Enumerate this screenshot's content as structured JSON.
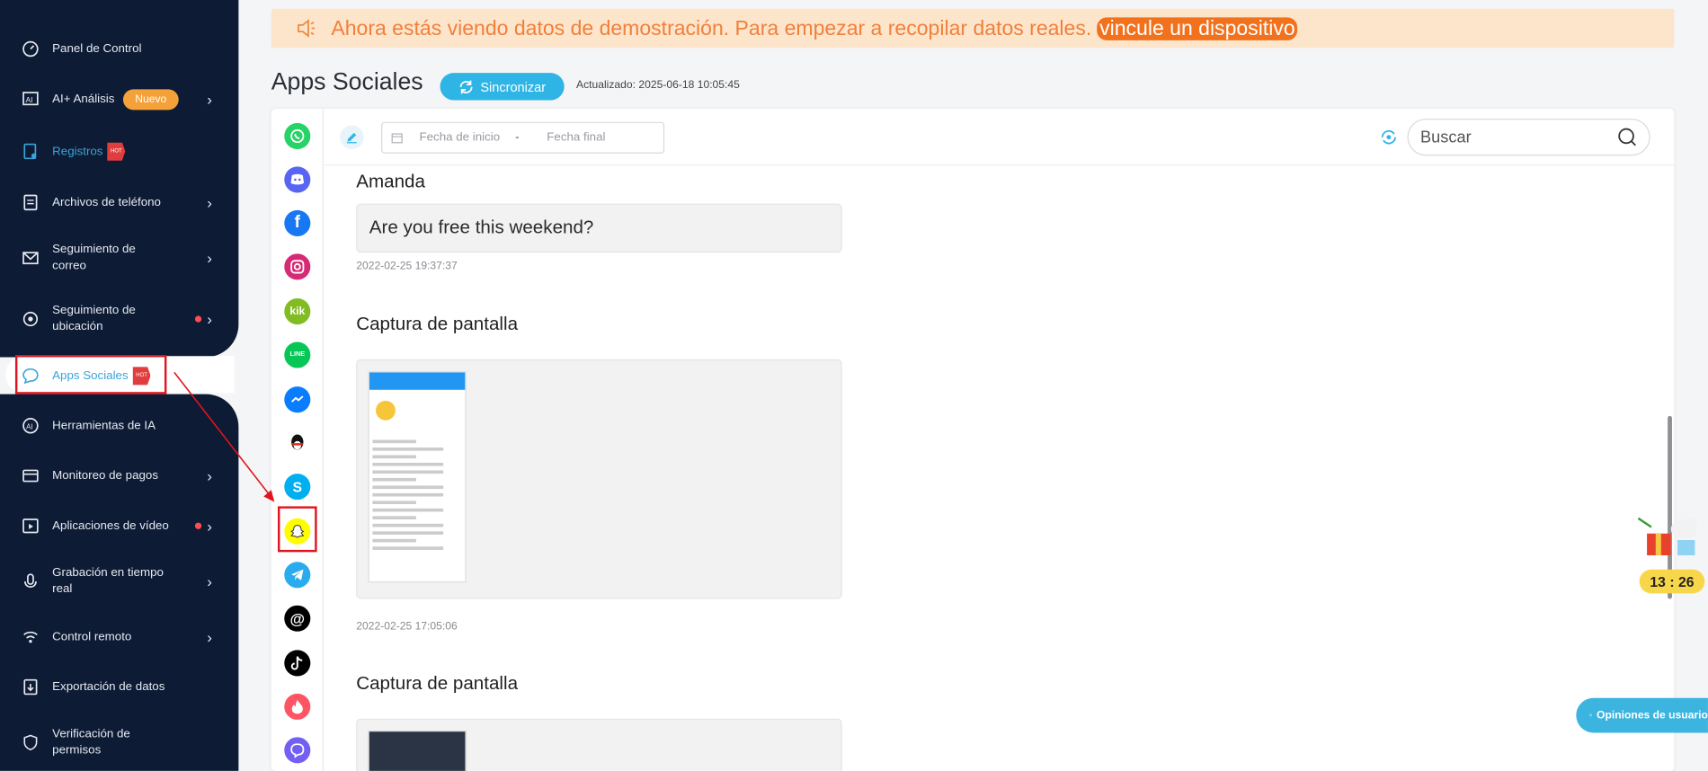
{
  "sidebar": {
    "items": [
      {
        "label": "Panel de Control",
        "icon": "dashboard-icon"
      },
      {
        "label": "AI+ Análisis",
        "badge": "Nuevo",
        "icon": "ai-icon"
      },
      {
        "label": "Registros",
        "icon": "records-icon"
      },
      {
        "label": "Archivos de teléfono",
        "icon": "files-icon"
      },
      {
        "label": "Seguimiento de correo",
        "icon": "mail-icon"
      },
      {
        "label": "Seguimiento de ubicación",
        "icon": "location-icon"
      },
      {
        "label": "Apps Sociales",
        "icon": "chat-icon"
      },
      {
        "label": "Herramientas de IA",
        "icon": "ai-tools-icon"
      },
      {
        "label": "Monitoreo de pagos",
        "icon": "card-icon"
      },
      {
        "label": "Aplicaciones de vídeo",
        "icon": "video-icon"
      },
      {
        "label": "Grabación en tiempo real",
        "icon": "mic-icon"
      },
      {
        "label": "Control remoto",
        "icon": "remote-icon"
      },
      {
        "label": "Exportación de datos",
        "icon": "export-icon"
      },
      {
        "label": "Verificación de permisos",
        "icon": "shield-icon"
      }
    ],
    "hot_label": "HOT"
  },
  "banner": {
    "text": "Ahora estás viendo datos de demostración. Para empezar a recopilar datos reales. ",
    "link": "vincule un dispositivo"
  },
  "header": {
    "title": "Apps Sociales",
    "sync_label": "Sincronizar",
    "updated": "Actualizado: 2025-06-18 10:05:45"
  },
  "toolbar": {
    "date_start_placeholder": "Fecha de inicio",
    "date_sep": "-",
    "date_end_placeholder": "Fecha final",
    "search_placeholder": "Buscar"
  },
  "apps": [
    "whatsapp",
    "discord",
    "facebook",
    "instagram",
    "kik",
    "line",
    "messenger",
    "qq",
    "skype",
    "snapchat",
    "telegram",
    "threads",
    "tiktok",
    "tinder",
    "viber"
  ],
  "app_glyphs": {
    "kik": "kik",
    "line": "LINE"
  },
  "feed": {
    "messages": [
      {
        "sender": "Amanda",
        "text": "Are you free this weekend?",
        "time": "2022-02-25 19:37:37"
      },
      {
        "sender": "Captura de pantalla",
        "time": "2022-02-25 17:05:06"
      },
      {
        "sender": "Captura de pantalla"
      }
    ]
  },
  "floating": {
    "timer": "13 : 26",
    "feedback": "Opiniones de usuario"
  },
  "colors": {
    "sidebar_bg": "#0d1b35",
    "accent": "#2eb5e6",
    "banner_bg": "#fde5cc",
    "banner_text": "#f0803a",
    "highlight": "#e0141e"
  }
}
